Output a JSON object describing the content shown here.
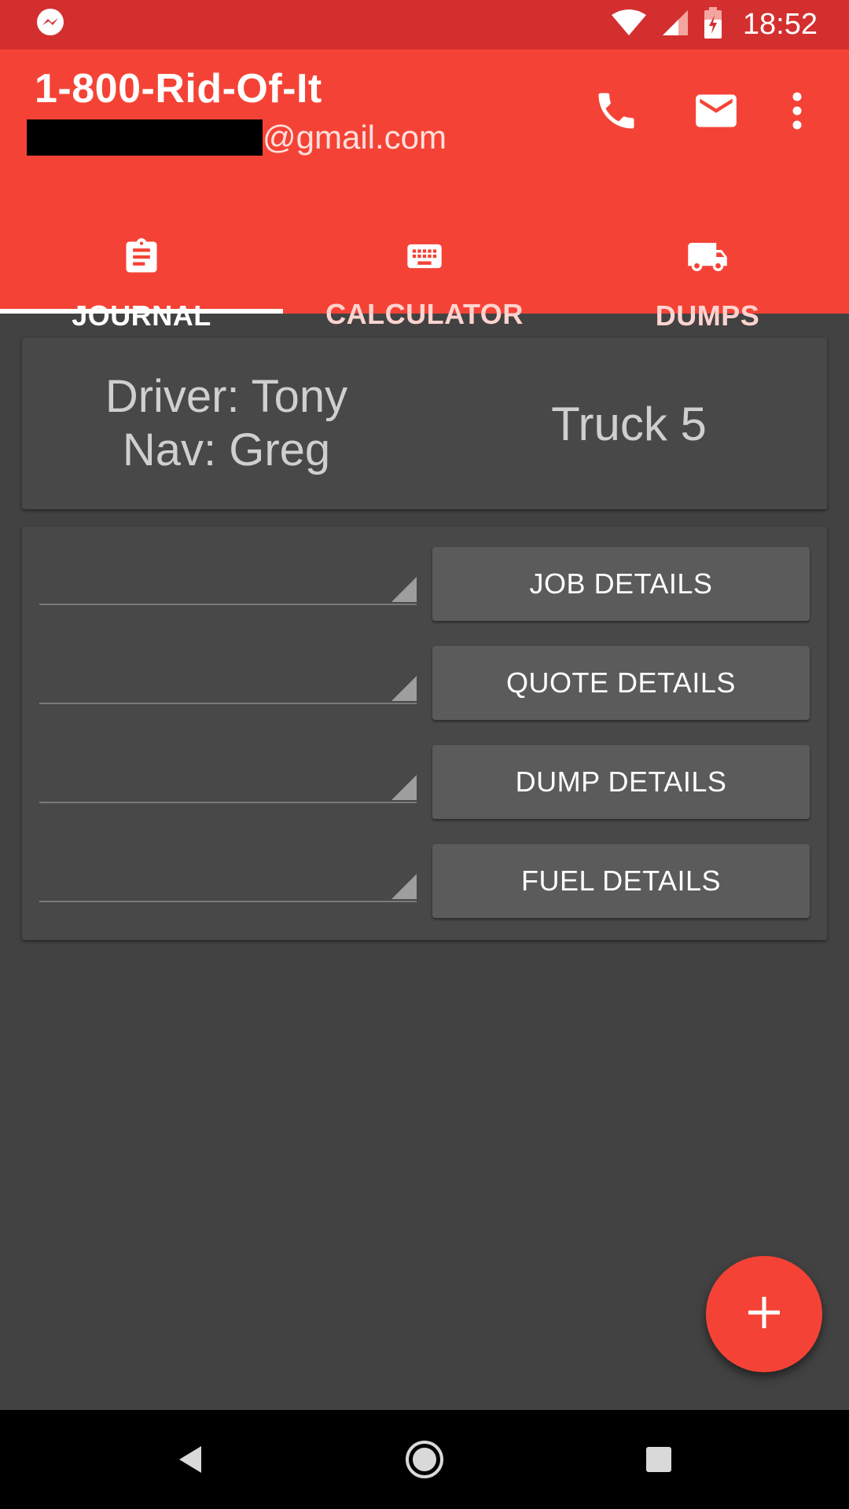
{
  "status_bar": {
    "time": "18:52",
    "icons": [
      "messenger-icon",
      "wifi-icon",
      "signal-icon",
      "battery-charging-icon"
    ]
  },
  "app_bar": {
    "title": "1-800-Rid-Of-It",
    "email_suffix": "@gmail.com",
    "actions": [
      "phone-icon",
      "email-icon",
      "more-vert-icon"
    ]
  },
  "tabs": [
    {
      "label": "JOURNAL",
      "icon": "clipboard-icon",
      "active": true
    },
    {
      "label": "CALCULATOR",
      "icon": "keyboard-icon",
      "active": false
    },
    {
      "label": "DUMPS",
      "icon": "truck-icon",
      "active": false
    }
  ],
  "crew": {
    "driver": "Driver: Tony",
    "nav": "Nav: Greg",
    "truck": "Truck 5"
  },
  "details": {
    "job_label": "JOB DETAILS",
    "quote_label": "QUOTE DETAILS",
    "dump_label": "DUMP DETAILS",
    "fuel_label": "FUEL DETAILS"
  },
  "fab": {
    "icon": "add-icon"
  },
  "nav_bar": {
    "icons": [
      "back-icon",
      "home-icon",
      "recents-icon"
    ]
  },
  "colors": {
    "primary": "#F44336",
    "primary_dark": "#D32F2F",
    "background": "#424242",
    "card": "#484848",
    "button": "#5B5B5B"
  }
}
